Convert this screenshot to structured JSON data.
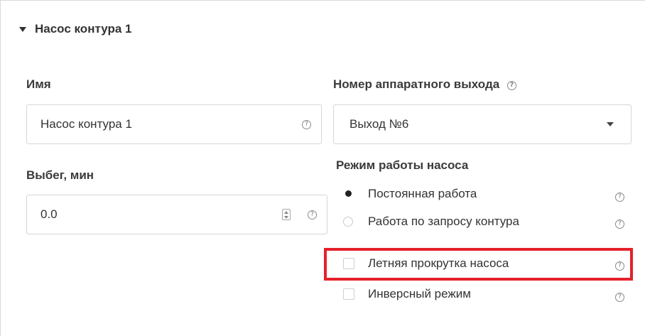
{
  "section": {
    "title": "Насос контура 1",
    "caret_icon": "caret-down-icon"
  },
  "name_field": {
    "label": "Имя",
    "value": "Насос контура 1",
    "help": "?"
  },
  "output_field": {
    "label": "Номер аппаратного выхода",
    "value": "Выход №6",
    "help": "?"
  },
  "overrun_field": {
    "label": "Выбег, мин",
    "value": "0.0",
    "help": "?"
  },
  "pump_mode": {
    "label": "Режим работы насоса",
    "options": [
      {
        "label": "Постоянная работа",
        "selected": true,
        "help": "?"
      },
      {
        "label": "Работа по запросу контура",
        "selected": false,
        "help": "?"
      }
    ]
  },
  "checkboxes": [
    {
      "label": "Летняя прокрутка насоса",
      "checked": false,
      "help": "?",
      "highlighted": true
    },
    {
      "label": "Инверсный режим",
      "checked": false,
      "help": "?"
    }
  ],
  "colors": {
    "highlight": "#e5212b",
    "text": "#333333",
    "border": "#d6d6d6"
  }
}
